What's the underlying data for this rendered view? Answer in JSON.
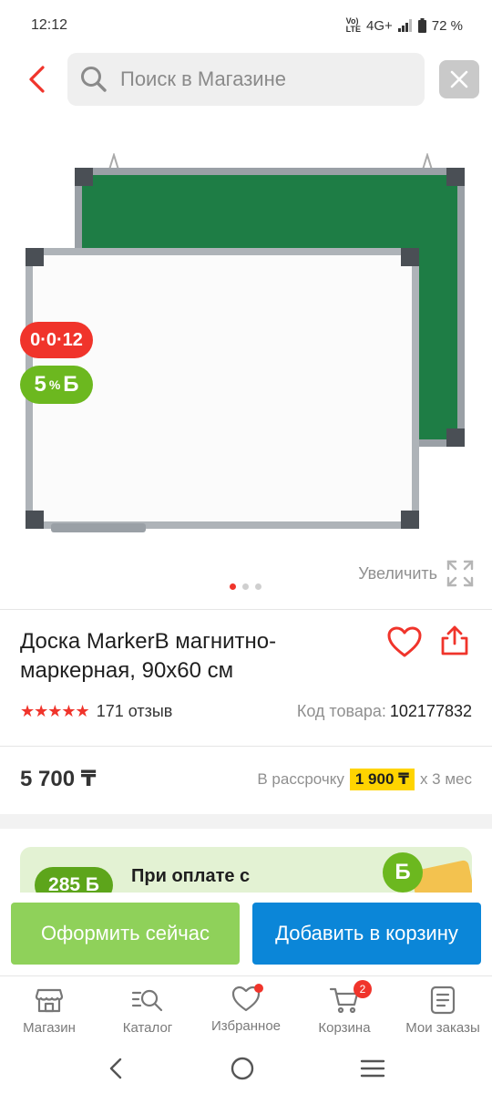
{
  "status_bar": {
    "time": "12:12",
    "network_top": "Vo)",
    "network_bottom": "LTE",
    "signal": "4G+",
    "battery": "72 %"
  },
  "search": {
    "placeholder": "Поиск в Магазине"
  },
  "gallery": {
    "timer_badge": "0·0·12",
    "bonus_badge_percent": "5",
    "bonus_badge_sup": "%",
    "bonus_badge_symbol": "Б",
    "zoom_label": "Увеличить",
    "slide_count": 3,
    "active_slide": 1
  },
  "product": {
    "title": "Доска MarkerB магнитно-маркерная, 90x60 см",
    "stars": "★★★★★",
    "rating": 4.5,
    "reviews": "171 отзыв",
    "code_label": "Код товара:",
    "code_value": "102177832",
    "price": "5 700 ₸",
    "installment_label": "В рассрочку",
    "installment_amount": "1 900 ₸",
    "installment_term": "х 3 мес"
  },
  "promo": {
    "bonus_amount": "285 Б",
    "text": "При оплате с\nKaspi Gold",
    "icon_symbol": "Б"
  },
  "actions": {
    "checkout_label": "Оформить сейчас",
    "add_to_cart_label": "Добавить в корзину"
  },
  "tabs": [
    {
      "label": "Магазин",
      "icon": "store-icon"
    },
    {
      "label": "Каталог",
      "icon": "catalog-search-icon"
    },
    {
      "label": "Избранное",
      "icon": "heart-icon",
      "has_dot": true
    },
    {
      "label": "Корзина",
      "icon": "cart-icon",
      "badge": "2"
    },
    {
      "label": "Мои заказы",
      "icon": "orders-icon"
    }
  ],
  "colors": {
    "brand_red": "#f0342b",
    "bonus_green": "#6cb81f",
    "checkout_green": "#8fd15a",
    "cart_blue": "#0b86d8",
    "installment_yellow": "#ffd400"
  }
}
